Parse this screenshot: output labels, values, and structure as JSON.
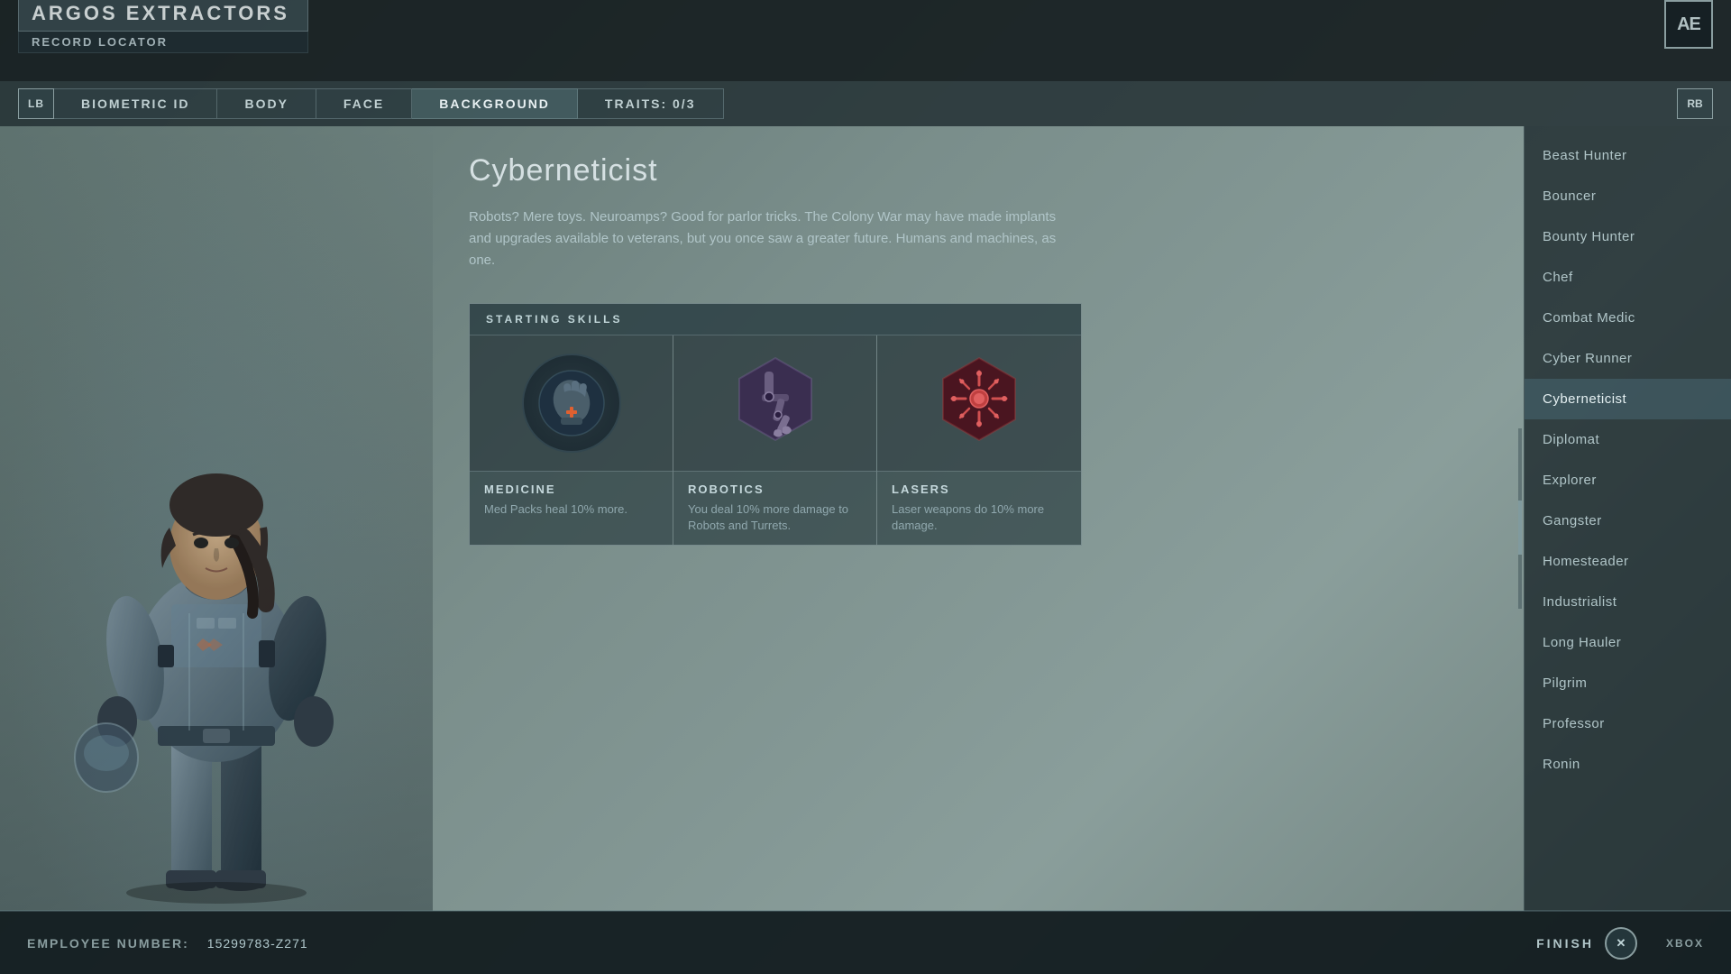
{
  "app": {
    "title": "ARGOS EXTRACTORS",
    "subtitle": "RECORD LOCATOR",
    "logo": "AE"
  },
  "nav": {
    "left_button": "LB",
    "right_button": "RB",
    "tabs": [
      {
        "id": "biometric",
        "label": "BIOMETRIC ID",
        "active": false
      },
      {
        "id": "body",
        "label": "BODY",
        "active": false
      },
      {
        "id": "face",
        "label": "FACE",
        "active": false
      },
      {
        "id": "background",
        "label": "BACKGROUND",
        "active": true
      },
      {
        "id": "traits",
        "label": "TRAITS: 0/3",
        "active": false
      }
    ]
  },
  "selected_background": {
    "name": "Cyberneticist",
    "description": "Robots? Mere toys. Neuroamps? Good for parlor tricks. The Colony War may have made implants and upgrades available to veterans, but you once saw a greater future. Humans and machines, as one.",
    "skills_header": "STARTING SKILLS",
    "skills": [
      {
        "id": "medicine",
        "name": "MEDICINE",
        "description": "Med Packs heal 10% more.",
        "icon_type": "medicine"
      },
      {
        "id": "robotics",
        "name": "ROBOTICS",
        "description": "You deal 10% more damage to Robots and Turrets.",
        "icon_type": "robotics"
      },
      {
        "id": "lasers",
        "name": "LASERS",
        "description": "Laser weapons do 10% more damage.",
        "icon_type": "lasers"
      }
    ]
  },
  "background_list": [
    {
      "id": "beast-hunter",
      "label": "Beast Hunter",
      "active": false
    },
    {
      "id": "bouncer",
      "label": "Bouncer",
      "active": false
    },
    {
      "id": "bounty-hunter",
      "label": "Bounty Hunter",
      "active": false
    },
    {
      "id": "chef",
      "label": "Chef",
      "active": false
    },
    {
      "id": "combat-medic",
      "label": "Combat Medic",
      "active": false
    },
    {
      "id": "cyber-runner",
      "label": "Cyber Runner",
      "active": false
    },
    {
      "id": "cyberneticist",
      "label": "Cyberneticist",
      "active": true
    },
    {
      "id": "diplomat",
      "label": "Diplomat",
      "active": false
    },
    {
      "id": "explorer",
      "label": "Explorer",
      "active": false
    },
    {
      "id": "gangster",
      "label": "Gangster",
      "active": false
    },
    {
      "id": "homesteader",
      "label": "Homesteader",
      "active": false
    },
    {
      "id": "industrialist",
      "label": "Industrialist",
      "active": false
    },
    {
      "id": "long-hauler",
      "label": "Long Hauler",
      "active": false
    },
    {
      "id": "pilgrim",
      "label": "Pilgrim",
      "active": false
    },
    {
      "id": "professor",
      "label": "Professor",
      "active": false
    },
    {
      "id": "ronin",
      "label": "Ronin",
      "active": false
    }
  ],
  "bottom": {
    "employee_label": "EMPLOYEE NUMBER:",
    "employee_number": "15299783-Z271",
    "finish_label": "FINISH",
    "finish_key": "✕",
    "xbox_label": "XBOX"
  }
}
